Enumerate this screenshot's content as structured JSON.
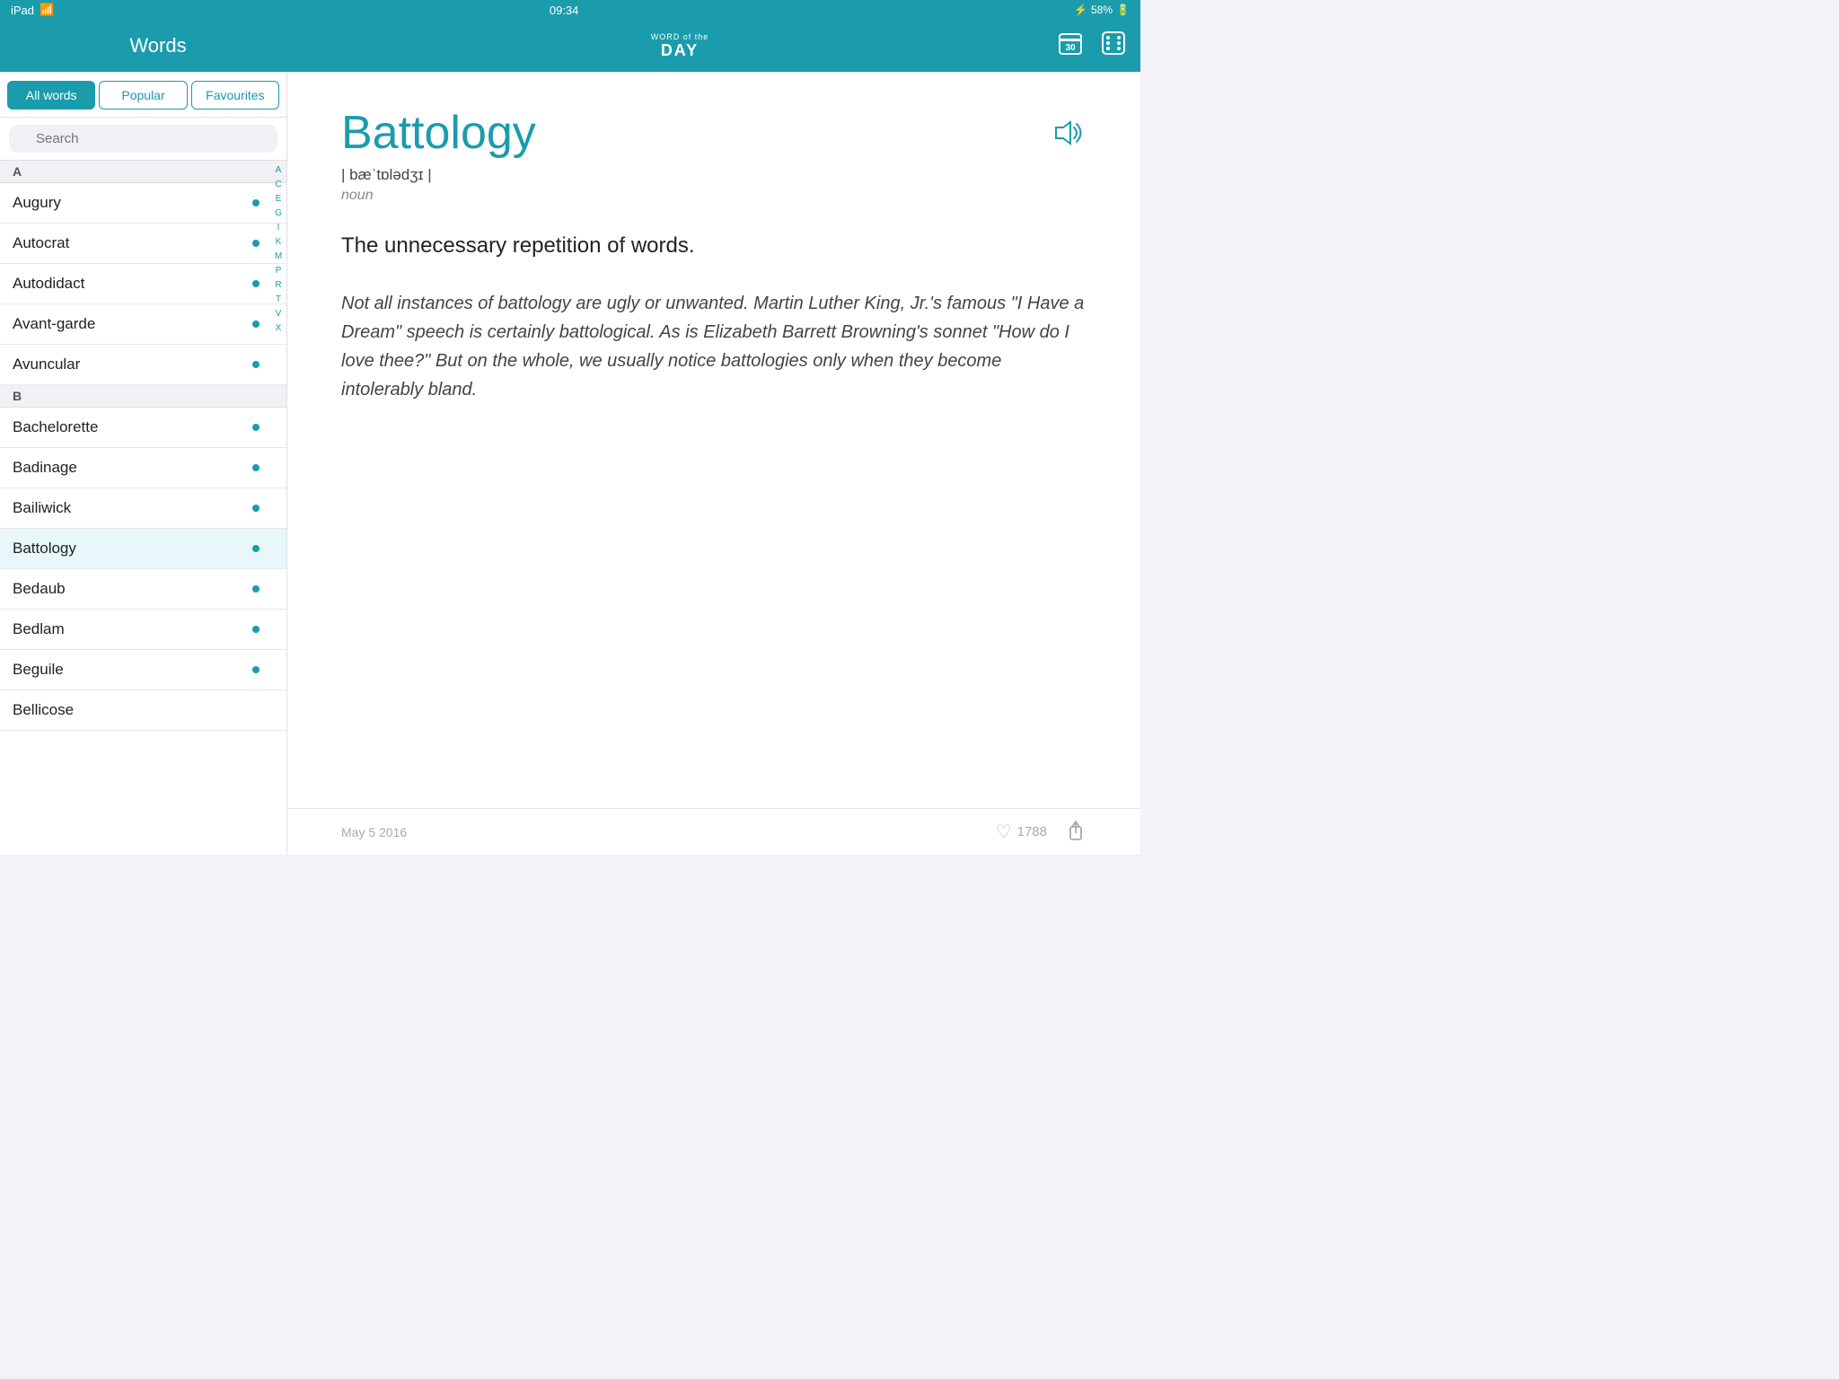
{
  "status": {
    "device": "iPad",
    "wifi": "wifi",
    "time": "09:34",
    "bluetooth": "58%",
    "battery_pct": 58
  },
  "header": {
    "title": "Words",
    "word_of_day_top": "WORD of the",
    "word_of_day_bottom": "DAY",
    "calendar_icon": "calendar",
    "dice_icon": "dice"
  },
  "tabs": {
    "all_words": "All words",
    "popular": "Popular",
    "favourites": "Favourites"
  },
  "search": {
    "placeholder": "Search"
  },
  "sections": [
    {
      "letter": "A",
      "words": [
        "Augury",
        "Autocrat",
        "Autodidact",
        "Avant-garde",
        "Avuncular"
      ]
    },
    {
      "letter": "B",
      "words": [
        "Bachelorette",
        "Badinage",
        "Bailiwick",
        "Battology",
        "Bedaub",
        "Bedlam",
        "Beguile",
        "Bellicose"
      ]
    }
  ],
  "alphabet": [
    "A",
    "C",
    "E",
    "G",
    "I",
    "K",
    "M",
    "P",
    "R",
    "T",
    "V",
    "X",
    "C"
  ],
  "active_word": "Battology",
  "word_detail": {
    "word": "Battology",
    "pronunciation": "| bæˈtɒlədʒɪ |",
    "part_of_speech": "noun",
    "definition": "The unnecessary repetition of words.",
    "example": "Not all instances of battology are ugly or unwanted. Martin Luther King, Jr.'s famous \"I Have a Dream\" speech is certainly battological. As is Elizabeth Barrett Browning's sonnet \"How do I love thee?\" But on the whole, we usually notice battologies only when they become intolerably bland.",
    "date": "May 5 2016",
    "likes": "1788"
  }
}
